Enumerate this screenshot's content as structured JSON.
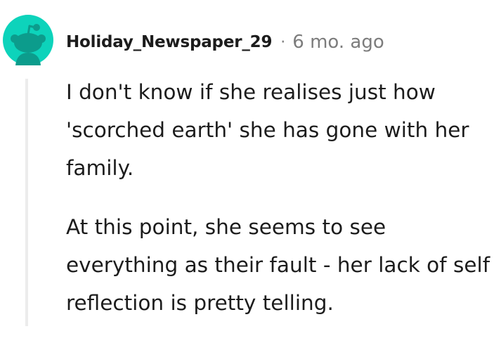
{
  "comment": {
    "author": "Holiday_Newspaper_29",
    "separator": "·",
    "timestamp": "6 mo. ago",
    "paragraphs": [
      "I don't know if she realises just how 'scorched earth' she has gone with her family.",
      "At this point, she seems to see everything as their fault - her lack of self reflection is pretty telling."
    ],
    "avatar_icon": "snoo-avatar-icon",
    "colors": {
      "avatar_bg": "#0dd3bb",
      "text": "#1c1c1c",
      "meta": "#7c7c7c",
      "thread_line": "#ececec"
    }
  }
}
